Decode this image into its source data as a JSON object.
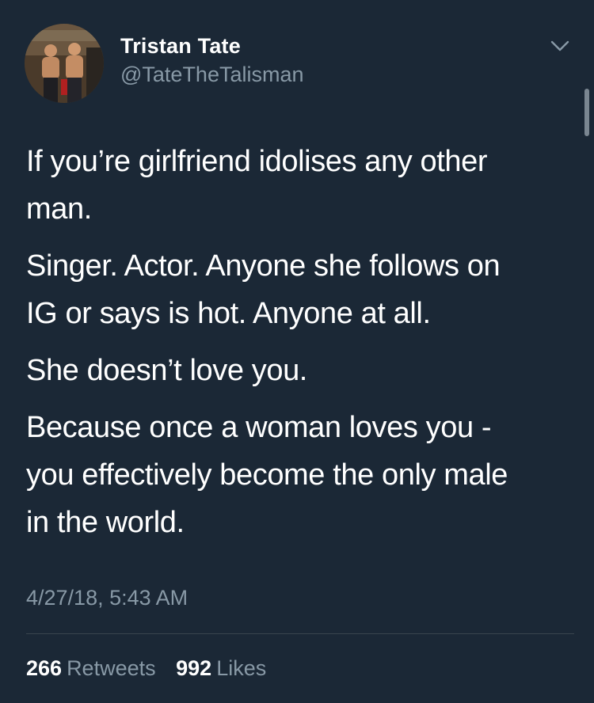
{
  "author": {
    "name": "Tristan Tate",
    "handle": "@TateTheTalisman"
  },
  "tweet": {
    "paragraphs": [
      "If you’re girlfriend idolises any other\nman.",
      "Singer. Actor. Anyone she follows on\nIG or says is hot. Anyone at all.",
      "She doesn’t love you.",
      "Because once a woman loves you  -\nyou effectively become the only male\nin the world."
    ],
    "timestamp": "4/27/18, 5:43 AM"
  },
  "stats": {
    "retweets": {
      "count": "266",
      "label": "Retweets"
    },
    "likes": {
      "count": "992",
      "label": "Likes"
    }
  },
  "icons": {
    "more_options": "chevron-down-icon"
  },
  "colors": {
    "background": "#1b2836",
    "primary_text": "#ffffff",
    "secondary_text": "#8899a6",
    "divider": "#38444d"
  }
}
